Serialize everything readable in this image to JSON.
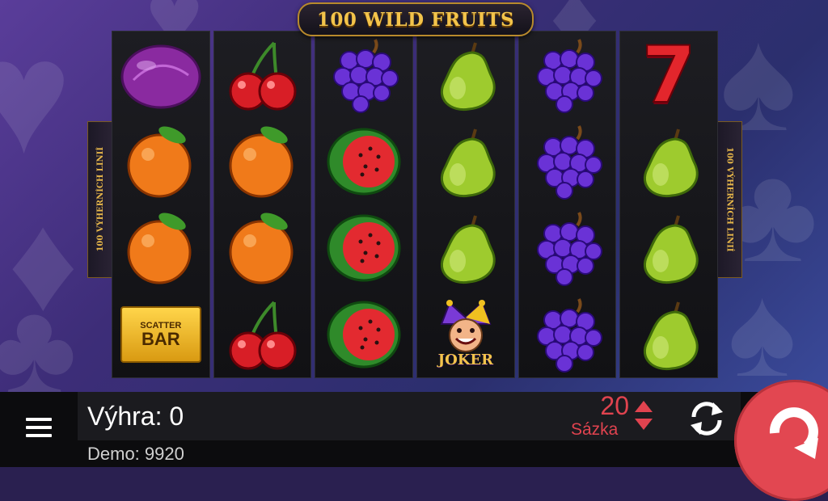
{
  "title": "100 WILD FRUITS",
  "side_label": "100 VÝHERNÍCH LINIÍ",
  "reels": [
    [
      "plum",
      "orange",
      "orange",
      "scatter-bar"
    ],
    [
      "cherry",
      "orange",
      "orange",
      "cherry"
    ],
    [
      "grapes",
      "watermelon",
      "watermelon",
      "watermelon"
    ],
    [
      "pear",
      "pear",
      "pear",
      "joker"
    ],
    [
      "grapes",
      "grapes",
      "grapes",
      "grapes"
    ],
    [
      "seven",
      "pear",
      "pear",
      "pear"
    ]
  ],
  "scatter": {
    "line1": "SCATTER",
    "line2": "BAR"
  },
  "joker_label": "JOKER",
  "seven_label": "7",
  "win": {
    "label": "Výhra:",
    "value": "0"
  },
  "demo": {
    "label": "Demo:",
    "value": "9920"
  },
  "bet": {
    "value": "20",
    "label": "Sázka"
  },
  "colors": {
    "accent": "#e24751",
    "bet": "#e0434f",
    "gold": "#f3c44b"
  }
}
